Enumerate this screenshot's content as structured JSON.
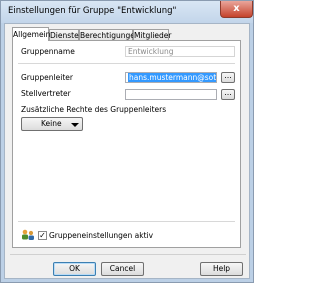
{
  "window": {
    "title": "Einstellungen für Gruppe \"Entwicklung\"",
    "close_glyph": "x"
  },
  "tabs": [
    {
      "label": "Allgemein",
      "active": true
    },
    {
      "label": "Dienste",
      "active": false
    },
    {
      "label": "Berechtigungen",
      "active": false
    },
    {
      "label": "Mitglieder",
      "active": false
    }
  ],
  "general": {
    "group_name_label": "Gruppenname",
    "group_name_value": "Entwicklung",
    "leader_label": "Gruppenleiter",
    "leader_value": "hans.mustermann@sotse.de",
    "deputy_label": "Stellvertreter",
    "deputy_value": "",
    "browse_label": "...",
    "extra_rights_label": "Zusätzliche Rechte des Gruppenleiters",
    "extra_rights_value": "Keine"
  },
  "footer": {
    "active_label": "Gruppeneinstellungen aktiv",
    "active_checked": true,
    "checkmark": "✓",
    "group_icon": "group-settings-icon"
  },
  "buttons": {
    "ok": "OK",
    "cancel": "Cancel",
    "help": "Help"
  }
}
